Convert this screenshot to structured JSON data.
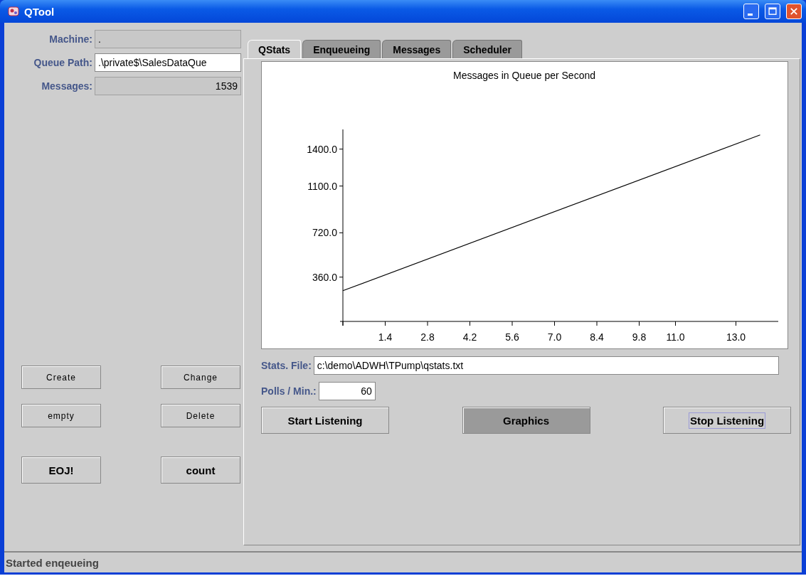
{
  "window": {
    "title": "QTool"
  },
  "fields": [
    {
      "label": "Machine:",
      "value": ".",
      "disabled": true,
      "kind": "text"
    },
    {
      "label": "Queue Path:",
      "value": ".\\private$\\SalesDataQue",
      "disabled": false,
      "kind": "text"
    },
    {
      "label": "Messages:",
      "value": "1539",
      "disabled": true,
      "kind": "number"
    }
  ],
  "queue_buttons": [
    {
      "label": "Create",
      "kind": "small"
    },
    {
      "label": "Change",
      "kind": "small"
    },
    {
      "label": "empty",
      "kind": "small"
    },
    {
      "label": "Delete",
      "kind": "small"
    },
    {
      "label": "EOJ!",
      "kind": "large"
    },
    {
      "label": "count",
      "kind": "large"
    }
  ],
  "tabs": [
    {
      "label": "QStats",
      "selected": true
    },
    {
      "label": "Enqueueing",
      "selected": false
    },
    {
      "label": "Messages",
      "selected": false
    },
    {
      "label": "Scheduler",
      "selected": false
    }
  ],
  "chart_data": {
    "type": "line",
    "title": "Messages in Queue per Second",
    "x": [
      0,
      13.8
    ],
    "series": [
      {
        "color": "#000000",
        "values": [
          250,
          1515
        ]
      }
    ],
    "xlim": [
      0,
      14.4
    ],
    "ylim": [
      0,
      1560
    ],
    "xticks": [
      1.4,
      2.8,
      4.2,
      5.6,
      {
        "value": 7,
        "label": "7.0"
      },
      8.4,
      9.8,
      {
        "value": 11,
        "label": "11.0"
      },
      {
        "value": 13,
        "label": "13.0"
      }
    ],
    "yticks": [
      {
        "value": 360,
        "label": "360.0"
      },
      {
        "value": 720,
        "label": "720.0"
      },
      {
        "value": 1100,
        "label": "1100.0"
      },
      {
        "value": 1400,
        "label": "1400.0"
      }
    ]
  },
  "stats_file": {
    "label": "Stats. File:",
    "value": "c:\\demo\\ADWH\\TPump\\qstats.txt"
  },
  "polls": {
    "label": "Polls / Min.:",
    "value": "60"
  },
  "actions": [
    {
      "label": "Start Listening",
      "pressed": false,
      "focused": false
    },
    {
      "label": "Graphics",
      "pressed": true,
      "focused": false
    },
    {
      "label": "Stop Listening",
      "pressed": false,
      "focused": true
    }
  ],
  "status_bar": "Started enqeueing"
}
